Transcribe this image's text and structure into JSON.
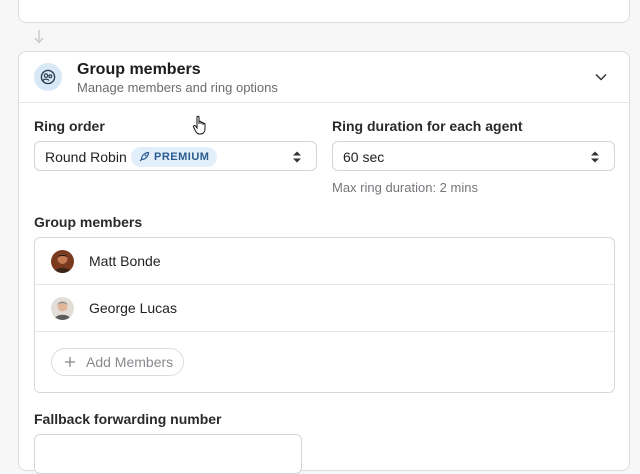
{
  "group": {
    "title": "Group members",
    "subtitle": "Manage members and ring options"
  },
  "ring_order": {
    "label": "Ring order",
    "value": "Round Robin",
    "badge": "PREMIUM"
  },
  "ring_duration": {
    "label": "Ring duration for each agent",
    "value": "60 sec",
    "helper": "Max ring duration: 2 mins"
  },
  "members": {
    "label": "Group members",
    "items": [
      {
        "name": "Matt Bonde"
      },
      {
        "name": "George Lucas"
      }
    ],
    "add_label": "Add Members"
  },
  "fallback": {
    "label": "Fallback forwarding number"
  }
}
